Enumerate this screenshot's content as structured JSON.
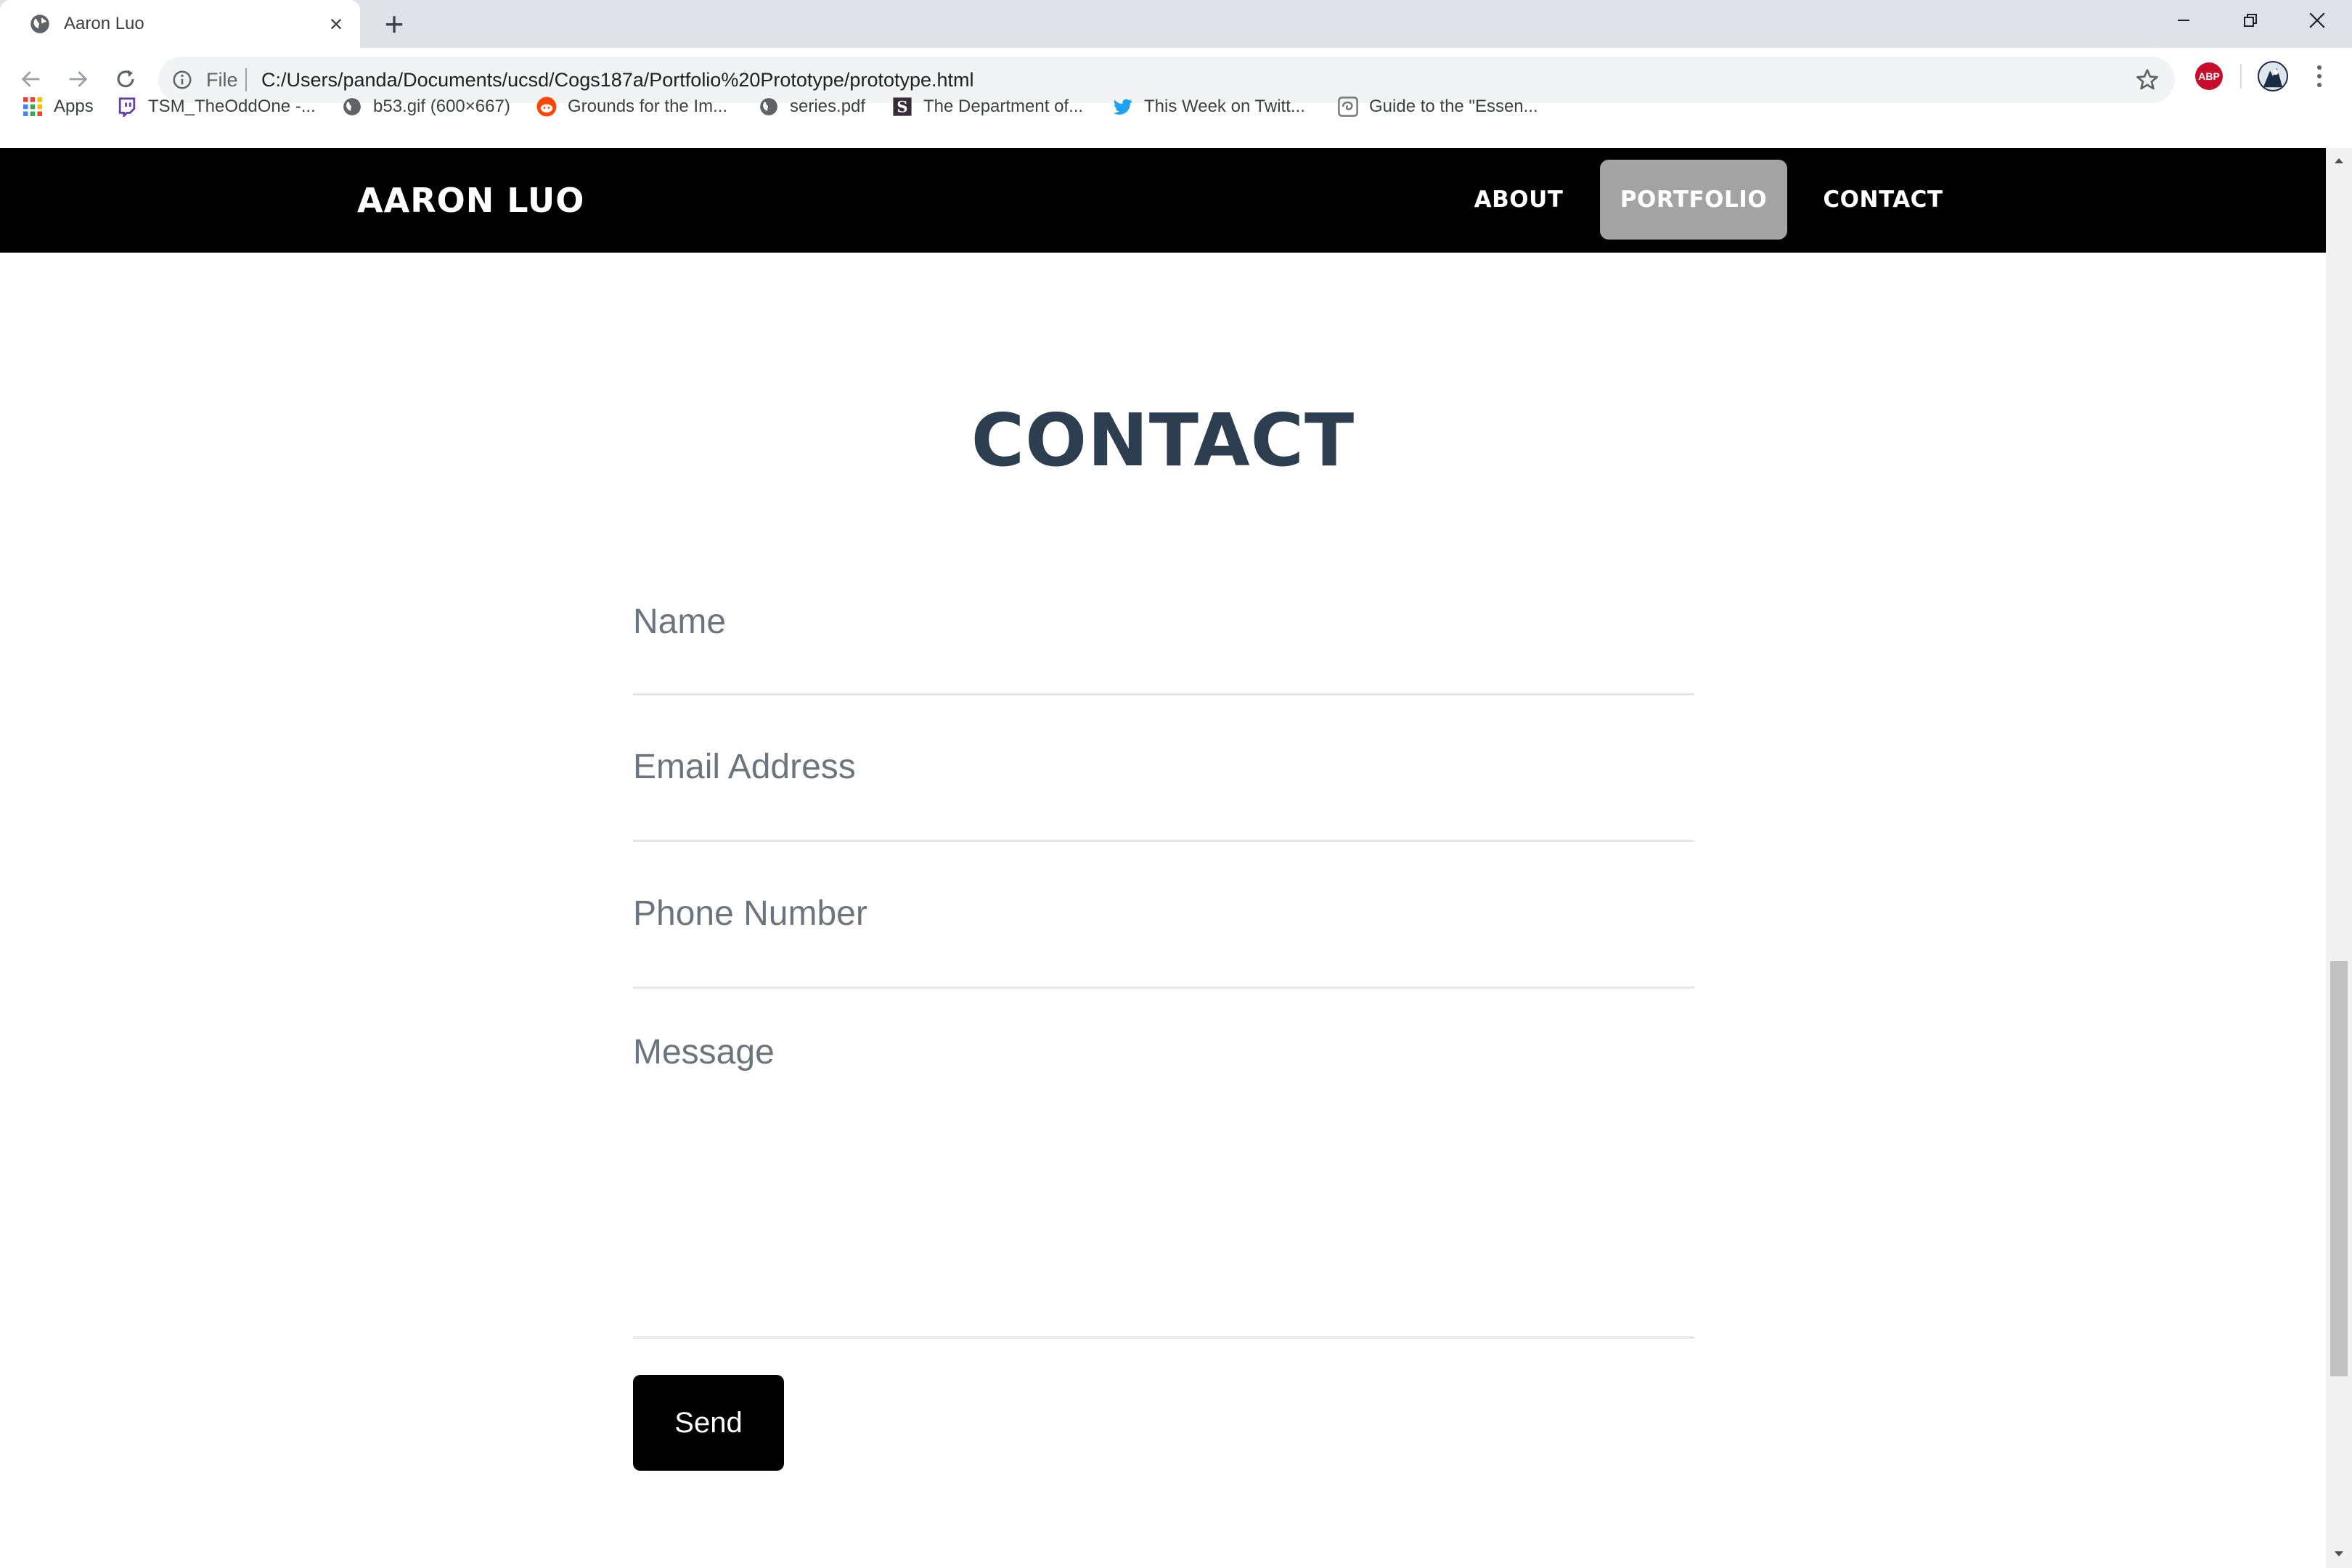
{
  "browser": {
    "tab": {
      "title": "Aaron Luo",
      "favicon": "globe-icon"
    },
    "new_tab_label": "+",
    "window_controls": [
      "minimize-icon",
      "restore-icon",
      "close-icon"
    ],
    "address_bar": {
      "scheme_label": "File",
      "url": "C:/Users/panda/Documents/ucsd/Cogs187a/Portfolio%20Prototype/prototype.html"
    },
    "extension_badge": "ABP",
    "bookmarks": [
      {
        "label": "Apps",
        "icon": "apps-grid-icon"
      },
      {
        "label": "TSM_TheOddOne -...",
        "icon": "twitch-icon"
      },
      {
        "label": "b53.gif (600×667)",
        "icon": "globe-icon"
      },
      {
        "label": "Grounds for the Im...",
        "icon": "reddit-icon"
      },
      {
        "label": "series.pdf",
        "icon": "globe-icon"
      },
      {
        "label": "The Department of...",
        "icon": "scribd-icon"
      },
      {
        "label": "This Week on Twitt...",
        "icon": "twitter-icon"
      },
      {
        "label": "Guide to the \"Essen...",
        "icon": "swirl-icon"
      }
    ]
  },
  "site": {
    "brand": "AARON LUO",
    "nav": [
      {
        "label": "ABOUT",
        "active": false
      },
      {
        "label": "PORTFOLIO",
        "active": true
      },
      {
        "label": "CONTACT",
        "active": false
      }
    ],
    "nav_active_color": "#a3a3a3",
    "heading": "CONTACT",
    "heading_color": "#2c3e50",
    "form": {
      "name_placeholder": "Name",
      "email_placeholder": "Email Address",
      "phone_placeholder": "Phone Number",
      "message_placeholder": "Message",
      "submit_label": "Send"
    }
  }
}
